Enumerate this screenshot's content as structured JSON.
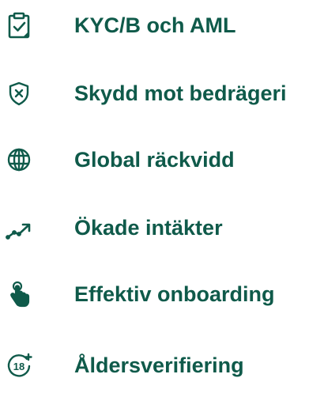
{
  "theme": {
    "text_color": "#0f5a4a",
    "icon_color": "#0f5a4a",
    "background": "#ffffff"
  },
  "features": [
    {
      "label": "KYC/B och AML",
      "icon": "clipboard-check-icon"
    },
    {
      "label": "Skydd mot bedrägeri",
      "icon": "shield-x-icon"
    },
    {
      "label": "Global räckvidd",
      "icon": "globe-icon"
    },
    {
      "label": "Ökade intäkter",
      "icon": "trending-up-icon"
    },
    {
      "label": "Effektiv onboarding",
      "icon": "hand-pointer-icon"
    },
    {
      "label": "Åldersverifiering",
      "icon": "age-18-plus-icon"
    }
  ]
}
